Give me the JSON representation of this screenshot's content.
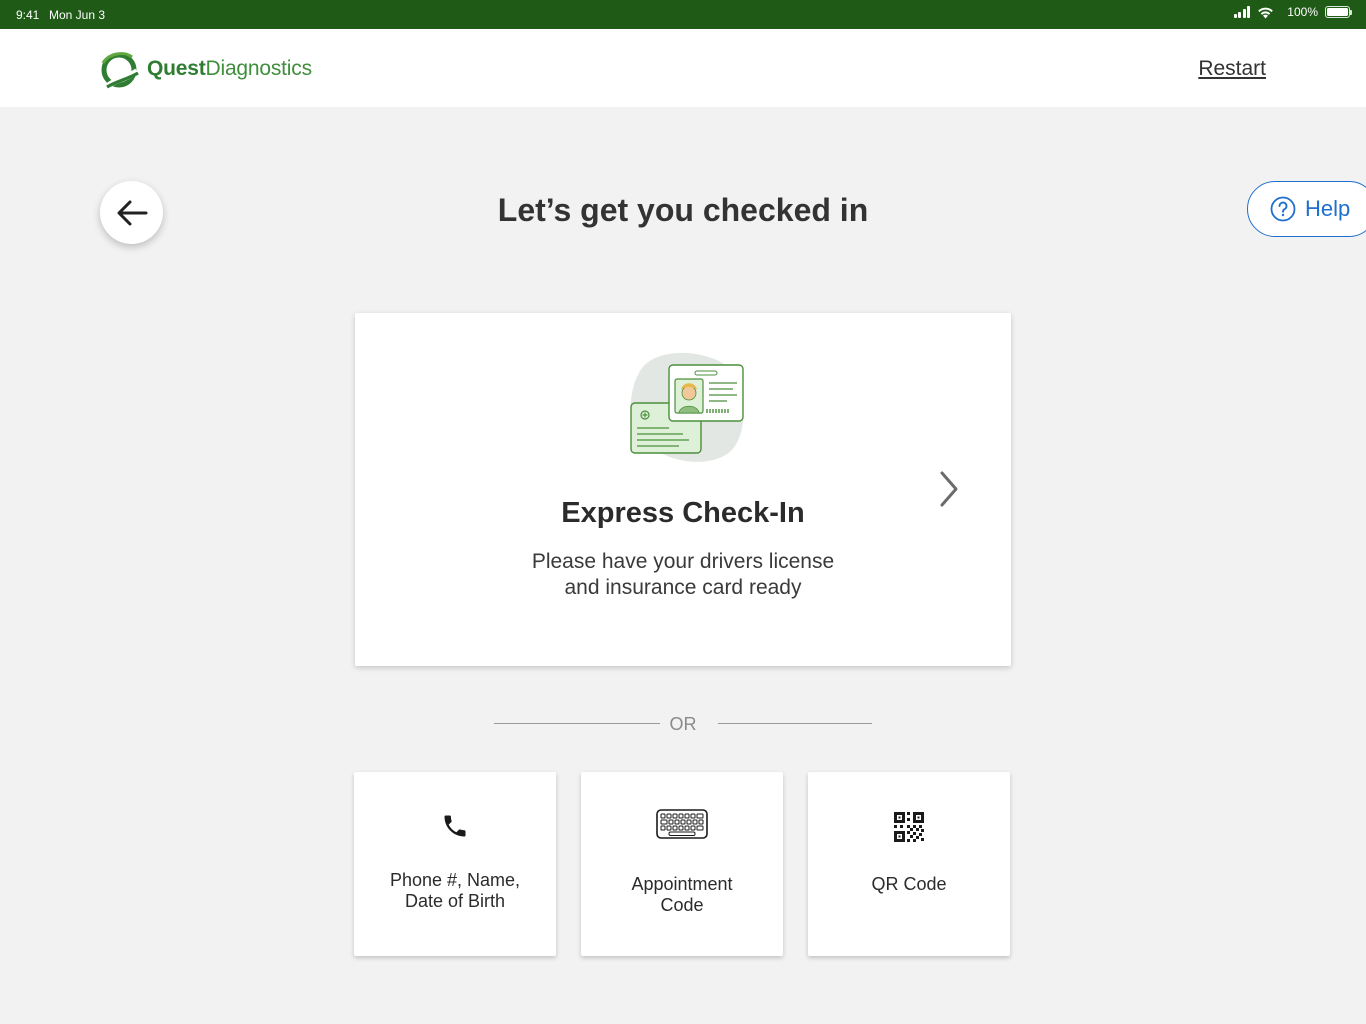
{
  "status_bar": {
    "time": "9:41",
    "date": "Mon Jun 3",
    "battery": "100%"
  },
  "header": {
    "logo_bold": "Quest",
    "logo_regular": "Diagnostics",
    "restart_label": "Restart"
  },
  "page": {
    "title": "Let’s get you checked in",
    "help_label": "Help"
  },
  "express": {
    "title": "Express Check-In",
    "desc_line1": "Please have your drivers license",
    "desc_line2": "and insurance card ready"
  },
  "divider": {
    "label": "OR"
  },
  "options": [
    {
      "label_line1": "Phone #, Name,",
      "label_line2": "Date of Birth",
      "icon": "phone-icon"
    },
    {
      "label_line1": "Appointment",
      "label_line2": "Code",
      "icon": "keyboard-icon"
    },
    {
      "label_line1": "QR Code",
      "label_line2": "",
      "icon": "qr-code-icon"
    }
  ],
  "colors": {
    "status_bar": "#1f5a17",
    "brand_green": "#2f7d32",
    "help_blue": "#1f6fcf",
    "background": "#f2f2f2"
  }
}
